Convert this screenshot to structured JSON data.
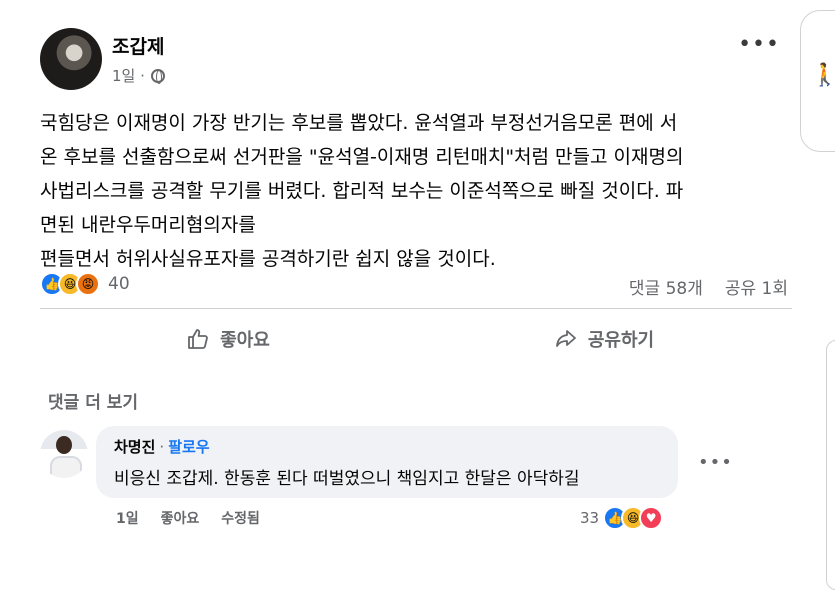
{
  "post": {
    "author": "조갑제",
    "time": "1일 ·",
    "text": "국힘당은 이재명이 가장 반기는 후보를 뽑았다. 윤석열과 부정선거음모론 편에 서\n온 후보를 선출함으로써 선거판을 \"윤석열-이재명 리턴매치\"처럼 만들고 이재명의\n사법리스크를 공격할 무기를 버렸다. 합리적 보수는 이준석쪽으로 빠질 것이다. 파\n면된 내란우두머리혐의자를\n편들면서 허위사실유포자를 공격하기란 쉽지 않을 것이다.",
    "reaction_count": "40",
    "comments_count": "댓글 58개",
    "shares_count": "공유 1회",
    "reaction_icons": [
      "like-icon",
      "haha-icon",
      "angry-icon"
    ]
  },
  "actions": {
    "like": "좋아요",
    "share": "공유하기"
  },
  "comments_section": {
    "more_comments": "댓글 더 보기",
    "comment": {
      "name": "차명진",
      "separator": "·",
      "follow": "팔로우",
      "text": "비응신 조갑제. 한동훈 된다 떠벌였으니 책임지고 한달은 아닥하길",
      "time": "1일",
      "like": "좋아요",
      "edited": "수정됨",
      "reaction_count": "33",
      "reaction_icons": [
        "like-icon",
        "haha-icon",
        "love-icon"
      ]
    }
  },
  "colors": {
    "accent": "#1877f2",
    "secondary_text": "#65676b",
    "bubble": "#f0f2f5"
  }
}
